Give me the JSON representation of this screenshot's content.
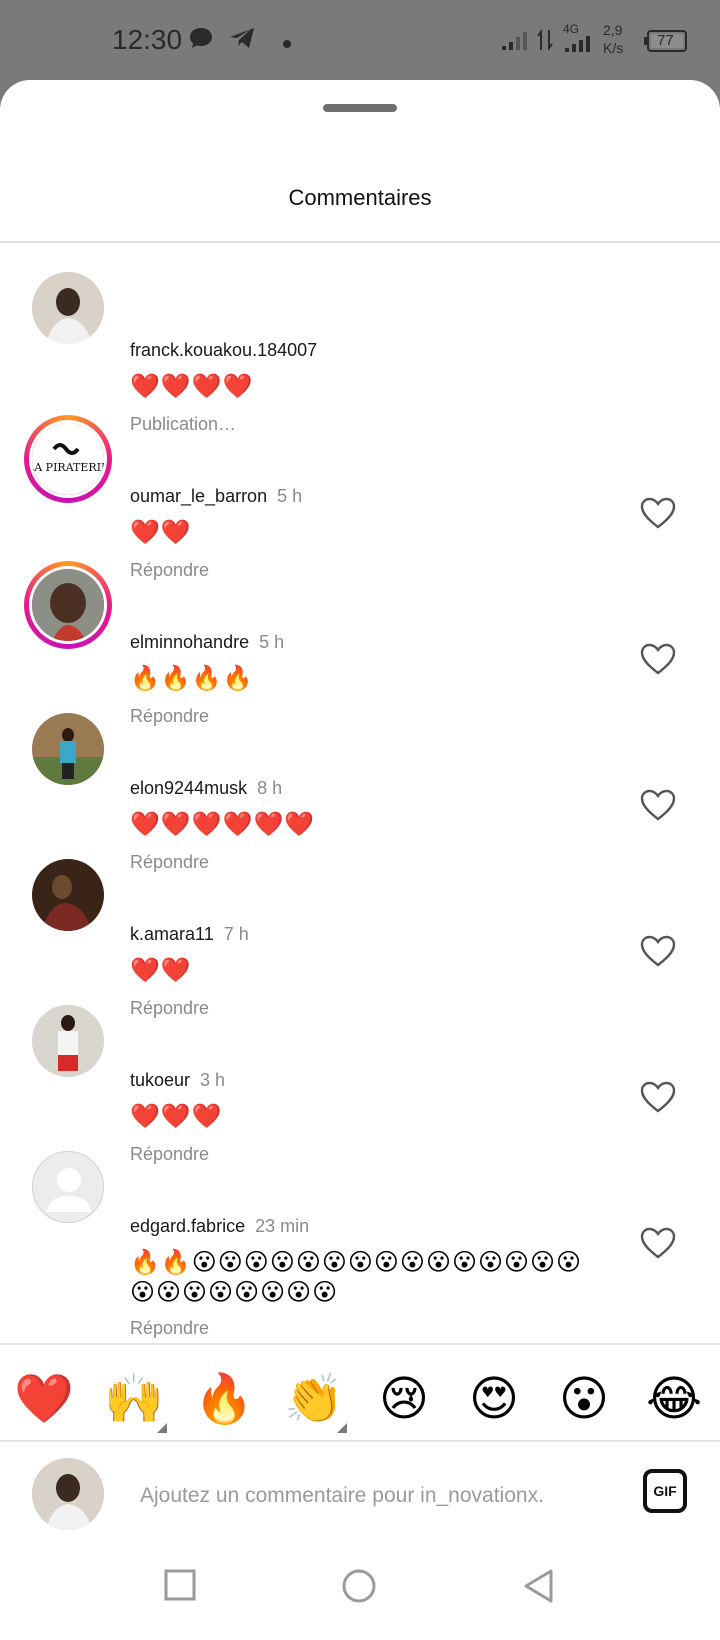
{
  "status_bar": {
    "time": "12:30",
    "network": "4G",
    "speed_value": "2,9",
    "speed_unit": "K/s",
    "battery": "77"
  },
  "sheet": {
    "title": "Commentaires"
  },
  "comments": [
    {
      "username": "franck.kouakou.184007",
      "time": "",
      "text": "❤️❤️❤️❤️",
      "action": "Publication…",
      "avatar": "avatar-photo",
      "story_ring": false,
      "has_like": false
    },
    {
      "username": "oumar_le_barron",
      "time": "5 h",
      "text": "❤️❤️",
      "action": "Répondre",
      "avatar": "la-piraterie-logo",
      "story_ring": true,
      "has_like": true
    },
    {
      "username": "elminnohandre",
      "time": "5 h",
      "text": "🔥🔥🔥🔥",
      "action": "Répondre",
      "avatar": "avatar-photo",
      "story_ring": true,
      "has_like": true
    },
    {
      "username": "elon9244musk",
      "time": "8 h",
      "text": "❤️❤️❤️❤️❤️❤️",
      "action": "Répondre",
      "avatar": "avatar-photo",
      "story_ring": false,
      "has_like": true
    },
    {
      "username": "k.amara11",
      "time": "7 h",
      "text": "❤️❤️",
      "action": "Répondre",
      "avatar": "avatar-photo",
      "story_ring": false,
      "has_like": true
    },
    {
      "username": "tukoeur",
      "time": "3 h",
      "text": "❤️❤️❤️",
      "action": "Répondre",
      "avatar": "avatar-photo",
      "story_ring": false,
      "has_like": true
    },
    {
      "username": "edgard.fabrice",
      "time": "23 min",
      "text": "🔥🔥😮😮😮😮😮😮😮😮😮😮😮😮😮😮😮😮😮😮😮😮😮😮😮",
      "action": "Répondre",
      "avatar": "default-avatar",
      "story_ring": false,
      "has_like": true
    }
  ],
  "reactions": [
    "❤️",
    "🙌",
    "🔥",
    "👏",
    "😢",
    "😍",
    "😮",
    "😂"
  ],
  "composer": {
    "placeholder": "Ajoutez un commentaire pour in_novationx.",
    "gif_label": "GIF"
  },
  "colors": {
    "status_bar_bg": "#7a7a7a",
    "secondary_text": "#8a8a8a",
    "story_ring_start": "#ff9b1f",
    "story_ring_end": "#c512b5"
  },
  "icons": {
    "like": "heart-outline-icon",
    "nav_recents": "square-icon",
    "nav_home": "circle-icon",
    "nav_back": "triangle-back-icon"
  }
}
